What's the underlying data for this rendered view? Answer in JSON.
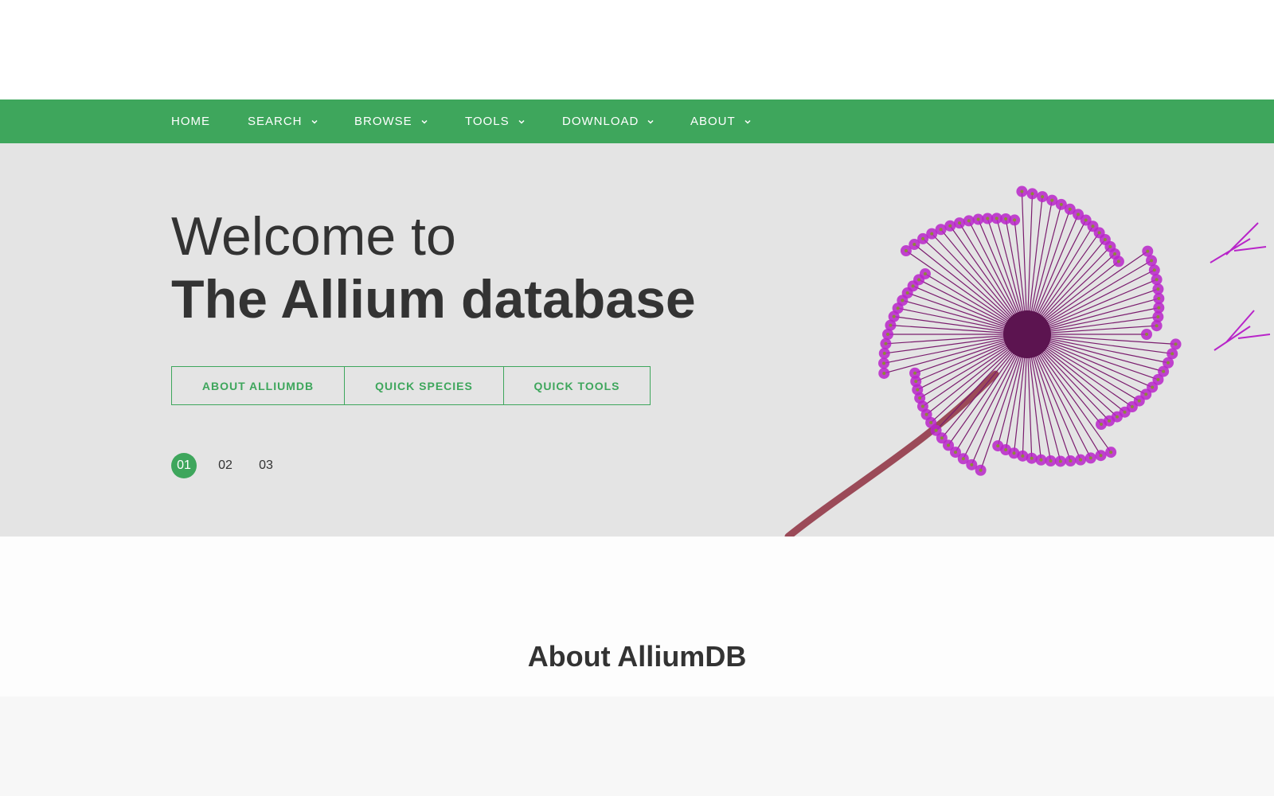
{
  "nav": {
    "items": [
      {
        "label": "HOME",
        "has_dropdown": false
      },
      {
        "label": "SEARCH",
        "has_dropdown": true
      },
      {
        "label": "BROWSE",
        "has_dropdown": true
      },
      {
        "label": "TOOLS",
        "has_dropdown": true
      },
      {
        "label": "DOWNLOAD",
        "has_dropdown": true
      },
      {
        "label": "ABOUT",
        "has_dropdown": true
      }
    ]
  },
  "hero": {
    "line1": "Welcome to",
    "line2": "The Allium database",
    "buttons": [
      {
        "label": "ABOUT ALLIUMDB"
      },
      {
        "label": "QUICK SPECIES"
      },
      {
        "label": "QUICK TOOLS"
      }
    ],
    "pager": [
      "01",
      "02",
      "03"
    ],
    "active_page": "01",
    "image": "allium-flower-icon"
  },
  "about": {
    "title": "About AlliumDB"
  },
  "colors": {
    "accent": "#3ea65c",
    "hero_bg": "#e4e4e4",
    "text": "#333333",
    "flower": "#b825c9"
  }
}
